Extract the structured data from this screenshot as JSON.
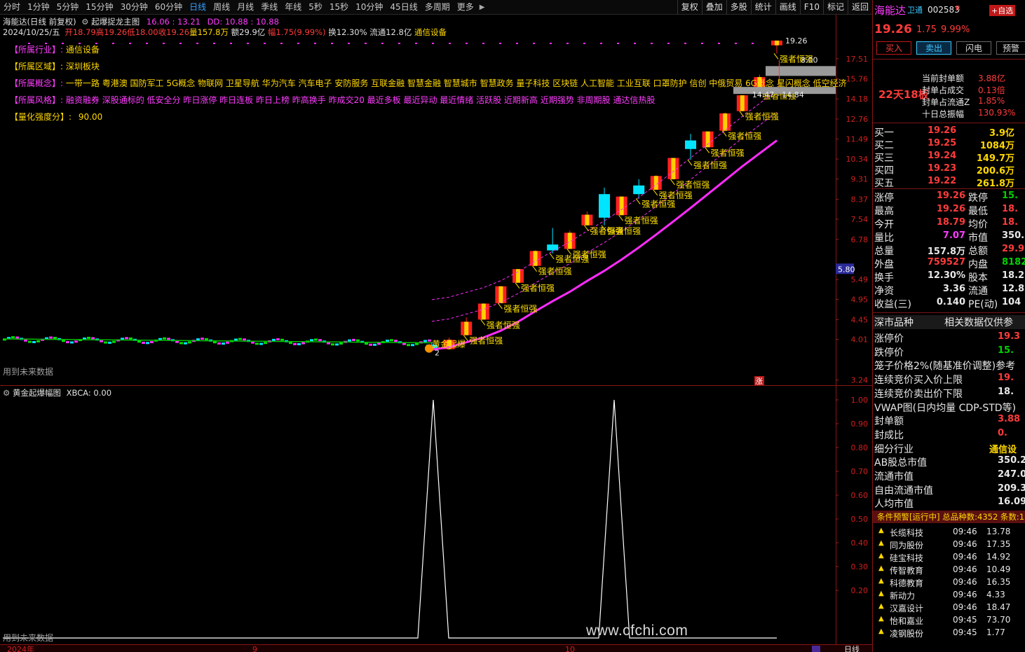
{
  "toolbar": {
    "periods": [
      "分时",
      "1分钟",
      "5分钟",
      "15分钟",
      "30分钟",
      "60分钟",
      "日线",
      "周线",
      "月线",
      "季线",
      "年线",
      "5秒",
      "15秒",
      "10分钟",
      "45日线",
      "多周期",
      "更多"
    ],
    "active_period": "日线",
    "tools": [
      "复权",
      "叠加",
      "多股",
      "统计",
      "画线",
      "F10",
      "标记",
      "返回"
    ]
  },
  "header": {
    "title": "海能达(日线 前复权)",
    "indicator": "起爆捉龙主图",
    "ind_values": "16.06 : 13.21",
    "dd": "DD: 10.88 : 10.88",
    "date": "2024/10/25/五",
    "open": "开18.79",
    "high": "高19.26",
    "low": "低18.00",
    "close": "收19.26",
    "volume": "量157.8万",
    "amount": "额29.9亿",
    "change": "幅1.75(9.99%)",
    "turnover": "换12.30%",
    "float_cap": "流通12.8亿",
    "industry_tag": "通信设备"
  },
  "info": {
    "industry_label": "【所属行业】:",
    "industry": "通信设备",
    "region_label": "【所属区域】:",
    "region": "深圳板块",
    "concept_label": "【所属概念】:",
    "concept": "一带一路 粤港澳 国防军工 5G概念 物联网 卫星导航 华为汽车 汽车电子 安防服务 互联金融 智慧金融 智慧城市 智慧政务 量子科技 区块链 人工智能 工业互联 口罩防护 信创 中俄贸易 6G概念 星闪概念 低空经济",
    "style_label": "【所属风格】:",
    "style": "融资融券 深股通标的 低安全分 昨日涨停 昨日连板 昨日上榜 昨高换手 昨成交20 最近多板 最近异动 最近情绪 活跃股 近期新高 近期强势 非周期股 通达信热股",
    "quant_label": "【量化强度分】:",
    "quant": "90.00"
  },
  "chart_data": [
    {
      "type": "candlestick",
      "title": "起爆捉龙主图",
      "y_axis_labels": [
        "17.51",
        "15.76",
        "14.18",
        "12.76",
        "11.49",
        "10.34",
        "9.31",
        "8.37",
        "7.54",
        "6.78",
        "5.49",
        "4.95",
        "4.45",
        "4.01",
        "3.24"
      ],
      "y_scale": "log",
      "ylim": [
        3.2,
        20.5
      ],
      "price_marker": "5.80",
      "annotation_high": "19.26",
      "annotation_low": "8.00",
      "annotation_range": "14.47 - 14.84",
      "signal_label": "强者恒强",
      "start_label": "黄金起爆",
      "start_number": "2",
      "footer_note": "用到未来数据",
      "limit_mark": "涨",
      "candles": [
        {
          "o": 3.9,
          "h": 3.95,
          "l": 3.76,
          "c": 3.8
        },
        {
          "o": 3.81,
          "h": 4.05,
          "l": 3.8,
          "c": 4.0
        },
        {
          "o": 4.1,
          "h": 4.5,
          "l": 4.1,
          "c": 4.4
        },
        {
          "o": 4.45,
          "h": 4.85,
          "l": 4.45,
          "c": 4.84
        },
        {
          "o": 4.85,
          "h": 5.3,
          "l": 4.85,
          "c": 5.3
        },
        {
          "o": 5.4,
          "h": 5.8,
          "l": 5.4,
          "c": 5.8
        },
        {
          "o": 5.9,
          "h": 6.4,
          "l": 5.9,
          "c": 6.38
        },
        {
          "o": 6.6,
          "h": 7.2,
          "l": 6.3,
          "c": 6.4
        },
        {
          "o": 6.45,
          "h": 7.1,
          "l": 6.45,
          "c": 7.02
        },
        {
          "o": 7.3,
          "h": 7.85,
          "l": 7.3,
          "c": 7.72
        },
        {
          "o": 8.6,
          "h": 8.9,
          "l": 7.3,
          "c": 7.6
        },
        {
          "o": 7.7,
          "h": 8.5,
          "l": 7.7,
          "c": 8.49
        },
        {
          "o": 9.0,
          "h": 9.3,
          "l": 8.4,
          "c": 8.6
        },
        {
          "o": 8.8,
          "h": 9.5,
          "l": 8.8,
          "c": 9.46
        },
        {
          "o": 9.3,
          "h": 10.4,
          "l": 9.3,
          "c": 10.4
        },
        {
          "o": 11.4,
          "h": 11.8,
          "l": 10.3,
          "c": 10.9
        },
        {
          "o": 11.0,
          "h": 11.95,
          "l": 11.0,
          "c": 11.95
        },
        {
          "o": 12.0,
          "h": 13.2,
          "l": 12.0,
          "c": 13.14
        },
        {
          "o": 13.3,
          "h": 14.47,
          "l": 13.3,
          "c": 14.45
        },
        {
          "o": 14.84,
          "h": 16.1,
          "l": 14.84,
          "c": 15.9
        },
        {
          "o": 18.79,
          "h": 19.26,
          "l": 18.0,
          "c": 19.26
        }
      ],
      "ma_line": [
        3.8,
        3.85,
        3.95,
        4.05,
        4.2,
        4.4,
        4.65,
        4.9,
        5.15,
        5.45,
        5.75,
        6.1,
        6.5,
        6.95,
        7.45,
        8.0,
        8.6,
        9.25,
        9.95,
        10.65,
        11.4
      ]
    },
    {
      "type": "line",
      "title": "黄金起爆幅图",
      "value_label": "XBCA: 0.00",
      "y_axis_labels": [
        "1.00",
        "0.90",
        "0.80",
        "0.70",
        "0.60",
        "0.50",
        "0.40",
        "0.30",
        "0.20"
      ],
      "ylim": [
        0,
        1
      ],
      "values": [
        0,
        0,
        0,
        0,
        0,
        0,
        0,
        0,
        0,
        0,
        0,
        1,
        0,
        0,
        0,
        0,
        0,
        1,
        0,
        0,
        0,
        0
      ],
      "footer_note": "用到未来数据",
      "x_labels": [
        "2024年",
        "9",
        "10"
      ],
      "period_label": "日线"
    }
  ],
  "quote": {
    "name": "海能达",
    "tag": "卫通",
    "code": "002583",
    "tag2": "R",
    "add_btn": "+自选",
    "price": "19.26",
    "change": "1.75",
    "pct": "9.99%",
    "buttons": [
      "买入",
      "卖出",
      "闪电",
      "预警"
    ],
    "streak": "22天18板",
    "seal_amount_label": "当前封单额",
    "seal_amount": "3.88亿",
    "seal_ratio_label": "封单占成交",
    "seal_ratio": "0.13倍",
    "seal_float_label": "封单占流通Z",
    "seal_float": "1.85%",
    "ten_day_label": "十日总振幅",
    "ten_day": "130.93%"
  },
  "bids": [
    {
      "label": "买一",
      "price": "19.26",
      "vol": "3.9亿"
    },
    {
      "label": "买二",
      "price": "19.25",
      "vol": "1084万"
    },
    {
      "label": "买三",
      "price": "19.24",
      "vol": "149.7万"
    },
    {
      "label": "买四",
      "price": "19.23",
      "vol": "200.6万"
    },
    {
      "label": "买五",
      "price": "19.22",
      "vol": "261.8万"
    }
  ],
  "stats": [
    {
      "l1": "涨停",
      "v1": "19.26",
      "l2": "跌停",
      "v2": "15."
    },
    {
      "l1": "最高",
      "v1": "19.26",
      "l2": "最低",
      "v2": "18."
    },
    {
      "l1": "今开",
      "v1": "18.79",
      "l2": "均价",
      "v2": "18."
    },
    {
      "l1": "量比",
      "v1": "7.07",
      "l2": "市值",
      "v2": "350.2"
    },
    {
      "l1": "总量",
      "v1": "157.8万",
      "l2": "总额",
      "v2": "29.9"
    },
    {
      "l1": "外盘",
      "v1": "759527",
      "l2": "内盘",
      "v2": "8182"
    },
    {
      "l1": "换手",
      "v1": "12.30%",
      "l2": "股本",
      "v2": "18.2"
    },
    {
      "l1": "净资",
      "v1": "3.36",
      "l2": "流通",
      "v2": "12.8"
    },
    {
      "l1": "收益(三)",
      "v1": "0.140",
      "l2": "PE(动)",
      "v2": "104"
    }
  ],
  "extra": {
    "header_left": "深市品种",
    "header_right": "相关数据仅供参",
    "rows": [
      {
        "label": "涨停价",
        "value": "19.3"
      },
      {
        "label": "跌停价",
        "value": "15."
      },
      {
        "label": "笼子价格2%(随基准价调整)参考",
        "value": ""
      },
      {
        "label": "连续竞价买入价上限",
        "value": "19."
      },
      {
        "label": "连续竞价卖出价下限",
        "value": "18."
      },
      {
        "label": "VWAP图(日内均量 CDP-STD等)",
        "value": ""
      },
      {
        "label": "封单额",
        "value": "3.88"
      },
      {
        "label": "封成比",
        "value": "0."
      },
      {
        "label": "细分行业",
        "value": "通信设"
      },
      {
        "label": "AB股总市值",
        "value": "350.2"
      },
      {
        "label": "流通市值",
        "value": "247.0"
      },
      {
        "label": "自由流通市值",
        "value": "209.3"
      },
      {
        "label": "人均市值",
        "value": "16.09"
      }
    ]
  },
  "alert_bar": "条件预警[运行中] 总品种数:4352 条数:1",
  "tickers": [
    {
      "name": "长缆科技",
      "time": "09:46",
      "price": "13.78"
    },
    {
      "name": "同为股份",
      "time": "09:46",
      "price": "17.35"
    },
    {
      "name": "硅宝科技",
      "time": "09:46",
      "price": "14.92"
    },
    {
      "name": "传智教育",
      "time": "09:46",
      "price": "10.49"
    },
    {
      "name": "科德教育",
      "time": "09:46",
      "price": "16.35"
    },
    {
      "name": "新动力",
      "time": "09:46",
      "price": "4.33"
    },
    {
      "name": "汉嘉设计",
      "time": "09:46",
      "price": "18.47"
    },
    {
      "name": "怡和嘉业",
      "time": "09:45",
      "price": "73.70"
    },
    {
      "name": "凌钢股份",
      "time": "09:45",
      "price": "1.77"
    }
  ],
  "watermark": "www.cfchi.com",
  "colors": {
    "up": "#ff2020",
    "up_fill": "#ffd000",
    "down": "#00e5ff",
    "ma": "#ff2cff",
    "signal": "#ffe000",
    "label_pink": "#ff3cff",
    "label_yellow": "#ffd800",
    "grid": "#8a1414"
  }
}
